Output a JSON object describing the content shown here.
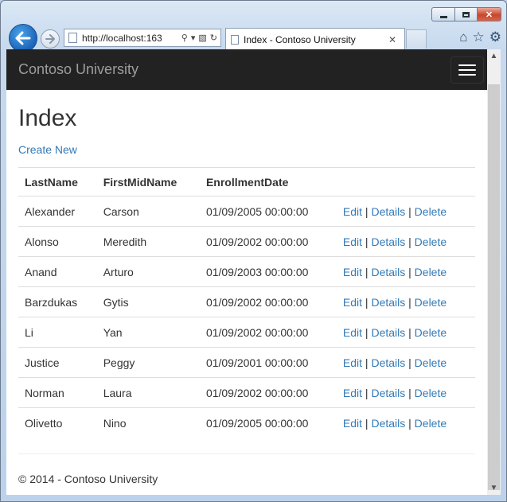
{
  "browser": {
    "url": "http://localhost:163",
    "tab_title": "Index - Contoso University",
    "tab_close": "✕"
  },
  "site": {
    "brand": "Contoso University"
  },
  "page": {
    "title": "Index",
    "create_link": "Create New"
  },
  "table": {
    "headers": [
      "LastName",
      "FirstMidName",
      "EnrollmentDate"
    ],
    "rows": [
      {
        "last": "Alexander",
        "first": "Carson",
        "date": "01/09/2005 00:00:00"
      },
      {
        "last": "Alonso",
        "first": "Meredith",
        "date": "01/09/2002 00:00:00"
      },
      {
        "last": "Anand",
        "first": "Arturo",
        "date": "01/09/2003 00:00:00"
      },
      {
        "last": "Barzdukas",
        "first": "Gytis",
        "date": "01/09/2002 00:00:00"
      },
      {
        "last": "Li",
        "first": "Yan",
        "date": "01/09/2002 00:00:00"
      },
      {
        "last": "Justice",
        "first": "Peggy",
        "date": "01/09/2001 00:00:00"
      },
      {
        "last": "Norman",
        "first": "Laura",
        "date": "01/09/2002 00:00:00"
      },
      {
        "last": "Olivetto",
        "first": "Nino",
        "date": "01/09/2005 00:00:00"
      }
    ],
    "actions": {
      "edit": "Edit",
      "details": "Details",
      "delete": "Delete",
      "separator": "|"
    }
  },
  "footer": {
    "text": "© 2014 - Contoso University"
  },
  "colors": {
    "link": "#337ab7",
    "navbar": "#222222"
  }
}
